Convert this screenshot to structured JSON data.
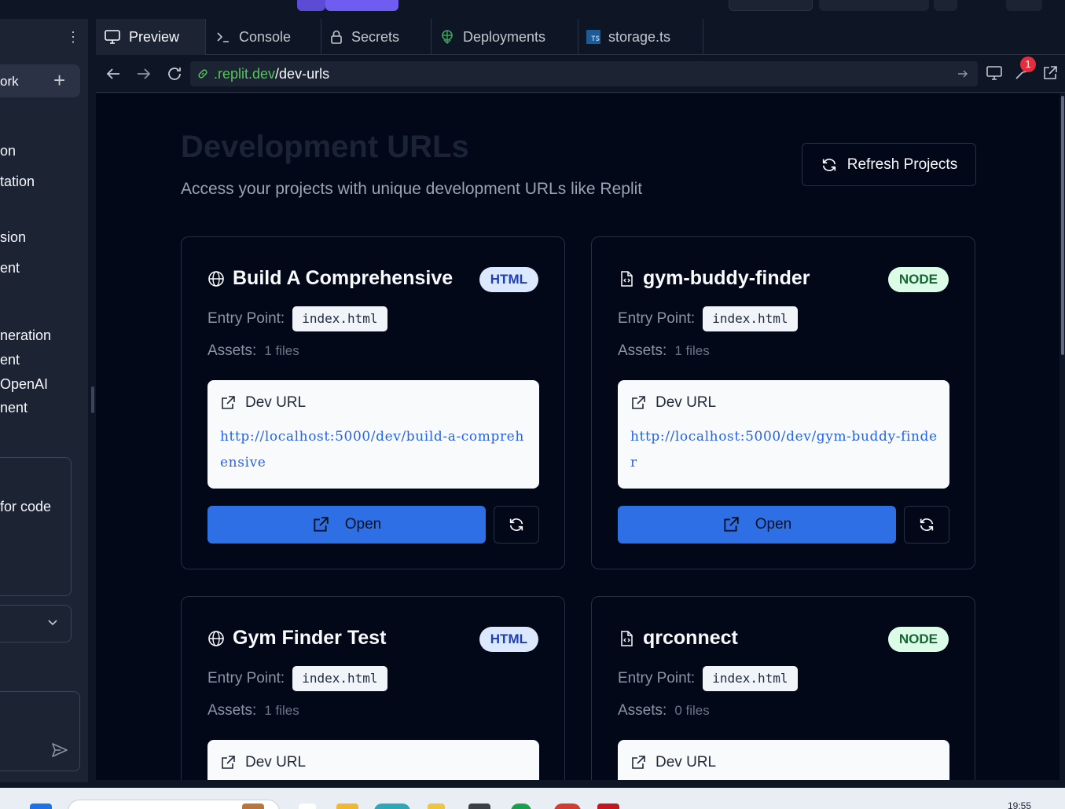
{
  "sidebar": {
    "new_tab_label": "ork",
    "items": [
      {
        "label": "on"
      },
      {
        "label": "tation"
      },
      {
        "label": "sion"
      },
      {
        "label": "ent"
      },
      {
        "label": "neration"
      },
      {
        "label": "ent"
      },
      {
        "label": "OpenAI"
      },
      {
        "label": "nent"
      }
    ],
    "box_text": "for code"
  },
  "tabs": [
    {
      "label": "Preview",
      "icon": "monitor-icon",
      "active": true
    },
    {
      "label": "Console",
      "icon": "terminal-icon",
      "active": false
    },
    {
      "label": "Secrets",
      "icon": "lock-icon",
      "active": false
    },
    {
      "label": "Deployments",
      "icon": "deploy-icon",
      "active": false
    },
    {
      "label": "storage.ts",
      "icon": "typescript-file-icon",
      "active": false
    }
  ],
  "ts_badge": "TS",
  "urlbar": {
    "host": ".replit.dev",
    "path": "/dev-urls",
    "notification_count": "1"
  },
  "page": {
    "title": "Development URLs",
    "subtitle": "Access your projects with unique development URLs like Replit",
    "refresh_label": "Refresh Projects",
    "entry_label": "Entry Point:",
    "assets_label": "Assets:",
    "dev_url_label": "Dev URL",
    "open_label": "Open"
  },
  "projects": [
    {
      "name": "Build A Comprehensive",
      "type": "HTML",
      "icon": "globe-icon",
      "entry": "index.html",
      "assets": "1 files",
      "url": "http://localhost:5000/dev/build-a-comprehensive"
    },
    {
      "name": "gym-buddy-finder",
      "type": "NODE",
      "icon": "file-code-icon",
      "entry": "index.html",
      "assets": "1 files",
      "url": "http://localhost:5000/dev/gym-buddy-finder"
    },
    {
      "name": "Gym Finder Test",
      "type": "HTML",
      "icon": "globe-icon",
      "entry": "index.html",
      "assets": "1 files",
      "url": ""
    },
    {
      "name": "qrconnect",
      "type": "NODE",
      "icon": "file-code-icon",
      "entry": "index.html",
      "assets": "0 files",
      "url": ""
    }
  ],
  "taskbar": {
    "clock": "19:55"
  },
  "colors": {
    "app_bg": "#0e1525",
    "page_bg": "#020817",
    "primary": "#2f6fe6",
    "url_host": "#58c45f",
    "html_badge_bg": "#dbe8fd",
    "node_badge_bg": "#dcfce7"
  }
}
